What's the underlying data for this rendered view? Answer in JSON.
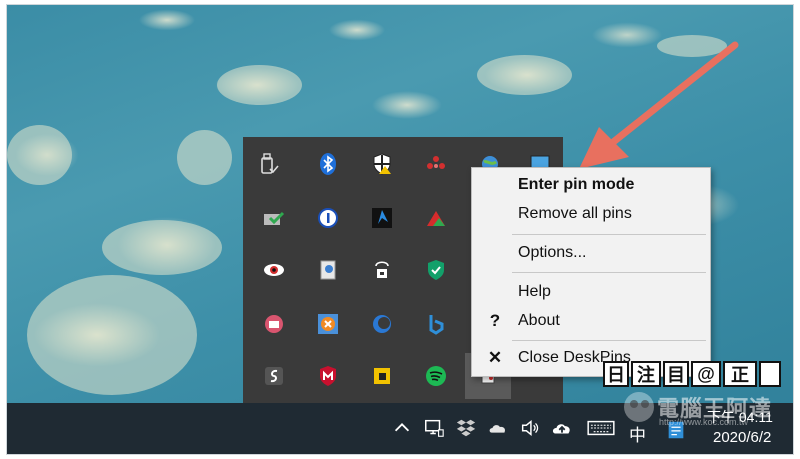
{
  "context_menu": {
    "items": [
      {
        "label": "Enter pin mode",
        "bold": true,
        "mark": ""
      },
      {
        "label": "Remove all pins",
        "bold": false,
        "mark": ""
      },
      {
        "label": "Options...",
        "bold": false,
        "mark": ""
      },
      {
        "label": "Help",
        "bold": false,
        "mark": ""
      },
      {
        "label": "About",
        "bold": false,
        "mark": "?"
      },
      {
        "label": "Close DeskPins",
        "bold": false,
        "mark": "✕"
      }
    ]
  },
  "taskbar": {
    "ime_label": "中",
    "clock_time": "下午 04:11",
    "clock_date": "2020/6/2"
  },
  "ime_toolbar": {
    "keys": [
      "日",
      "注",
      "目",
      "@",
      "正",
      ""
    ]
  },
  "watermark": {
    "text": "電腦王阿達",
    "subtext": "http://www.koc.com.tw"
  },
  "tray_icons": [
    "usb-eject-icon",
    "bluetooth-icon",
    "security-shield-icon",
    "red-dots-app-icon",
    "network-globe-icon",
    "monitor-app-icon",
    "shield-check-icon",
    "1password-icon",
    "blue-arrow-app-icon",
    "red-triangle-app-icon",
    "eye-app-icon",
    "document-tool-icon",
    "lock-network-icon",
    "green-shield-icon",
    "pink-camera-app-icon",
    "orange-target-icon",
    "blue-moon-icon",
    "bing-icon",
    "dark-s-app-icon",
    "mcafee-icon",
    "yellow-box-app-icon",
    "spotify-icon",
    "deskpins-icon"
  ],
  "colors": {
    "taskbar": "#1f2a33",
    "flyout": "#3a3a3a",
    "menu": "#f2f2f2",
    "arrow": "#e8705f"
  }
}
